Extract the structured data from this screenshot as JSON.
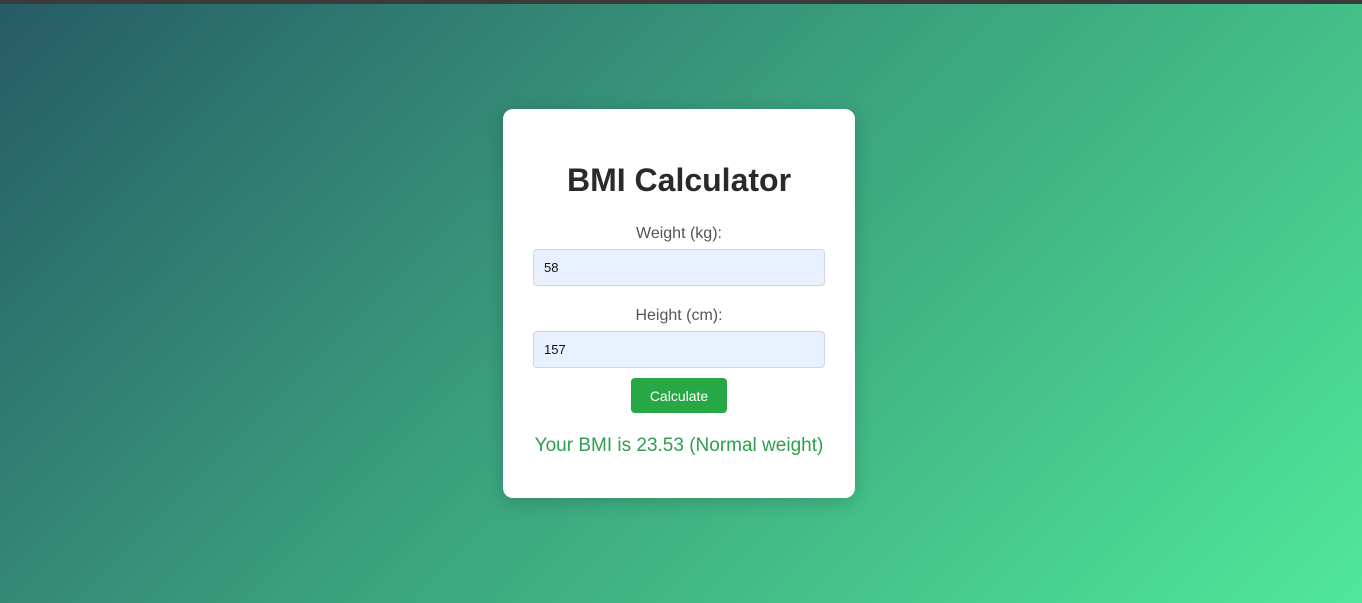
{
  "page": {
    "title": "BMI Calculator"
  },
  "form": {
    "weight": {
      "label": "Weight (kg):",
      "value": "58"
    },
    "height": {
      "label": "Height (cm):",
      "value": "157"
    },
    "calculate_label": "Calculate"
  },
  "result": {
    "text": "Your BMI is 23.53 (Normal weight)"
  },
  "colors": {
    "button": "#28a745",
    "result_text": "#2e9e4f",
    "input_background": "#e8f0fe",
    "gradient_start": "#265b66",
    "gradient_end": "#50e898"
  }
}
